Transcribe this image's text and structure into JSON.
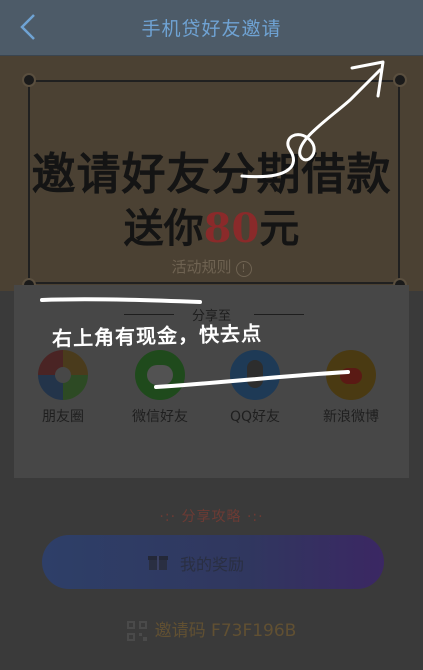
{
  "nav": {
    "title": "手机贷好友邀请",
    "back_icon": "chevron-left-icon"
  },
  "banner": {
    "headline": "邀请好友分期借款",
    "subline_prefix": "送你",
    "amount": "80",
    "subline_suffix": "元",
    "rules_link": "活动规则",
    "rules_icon": "info-icon"
  },
  "share": {
    "title": "分享至",
    "targets": [
      {
        "label": "朋友圈",
        "icon": "moments-icon"
      },
      {
        "label": "微信好友",
        "icon": "wechat-icon"
      },
      {
        "label": "QQ好友",
        "icon": "qq-icon"
      },
      {
        "label": "新浪微博",
        "icon": "weibo-icon"
      }
    ]
  },
  "overlay": {
    "text": "右上角有现金，快去点"
  },
  "strategy": {
    "label": "分享攻略"
  },
  "reward_button": {
    "label": "我的奖励",
    "icon": "gift-icon"
  },
  "invite": {
    "label": "邀请码",
    "code": "F73F196B",
    "icon": "qr-code-icon"
  },
  "colors": {
    "nav_text": "#6fa3d4",
    "amount": "#8a2a2a",
    "button_left": "#2e3f68",
    "button_right": "#3b2763"
  }
}
